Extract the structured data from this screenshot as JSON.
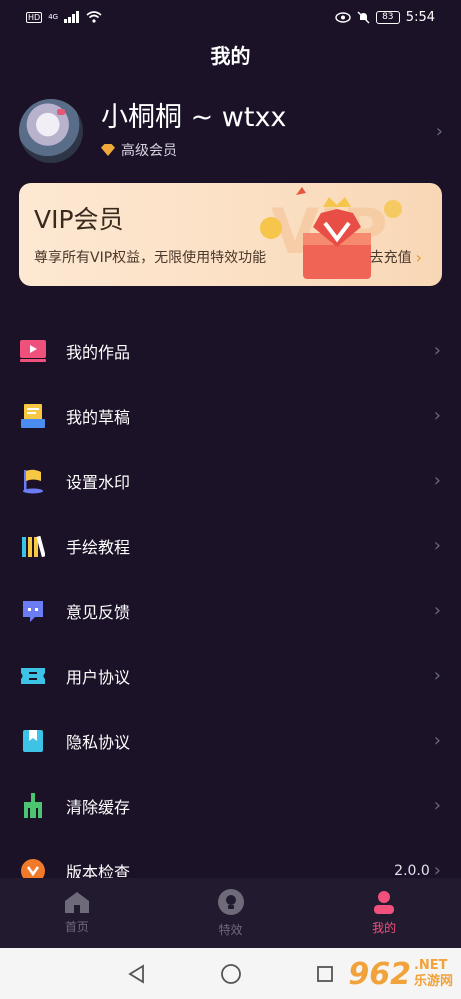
{
  "status_bar": {
    "left_indicators": "HD",
    "network": "4G",
    "battery": "83",
    "time": "5:54"
  },
  "header": {
    "title": "我的"
  },
  "profile": {
    "name": "小桐桐 ~ wtxx",
    "member_level": "高级会员"
  },
  "vip_card": {
    "title": "VIP会员",
    "description": "尊享所有VIP权益，无限使用特效功能",
    "action_label": "去充值"
  },
  "menu": {
    "items": [
      {
        "label": "我的作品",
        "icon": "play-video-icon",
        "color": "#f0507c"
      },
      {
        "label": "我的草稿",
        "icon": "draft-box-icon",
        "color": "#f7c844"
      },
      {
        "label": "设置水印",
        "icon": "flag-icon",
        "color": "#f7c844"
      },
      {
        "label": "手绘教程",
        "icon": "books-icon",
        "color": "#f7c844"
      },
      {
        "label": "意见反馈",
        "icon": "chat-bubble-icon",
        "color": "#6b7cf5"
      },
      {
        "label": "用户协议",
        "icon": "ticket-icon",
        "color": "#3cc3e6"
      },
      {
        "label": "隐私协议",
        "icon": "bookmark-box-icon",
        "color": "#3cc3e6"
      },
      {
        "label": "清除缓存",
        "icon": "broom-icon",
        "color": "#4cc470"
      },
      {
        "label": "版本检查",
        "icon": "version-icon",
        "color": "#f07a2a",
        "value": "2.0.0"
      }
    ]
  },
  "tabbar": {
    "tabs": [
      {
        "label": "首页",
        "icon": "home-icon",
        "active": false
      },
      {
        "label": "特效",
        "icon": "effects-icon",
        "active": false
      },
      {
        "label": "我的",
        "icon": "profile-icon",
        "active": true
      }
    ]
  },
  "watermark": {
    "number": "962",
    "domain": ".NET",
    "name": "乐游网"
  },
  "colors": {
    "background": "#1b1228",
    "accent": "#f0507c",
    "vip_card": "#fbe0c4"
  }
}
